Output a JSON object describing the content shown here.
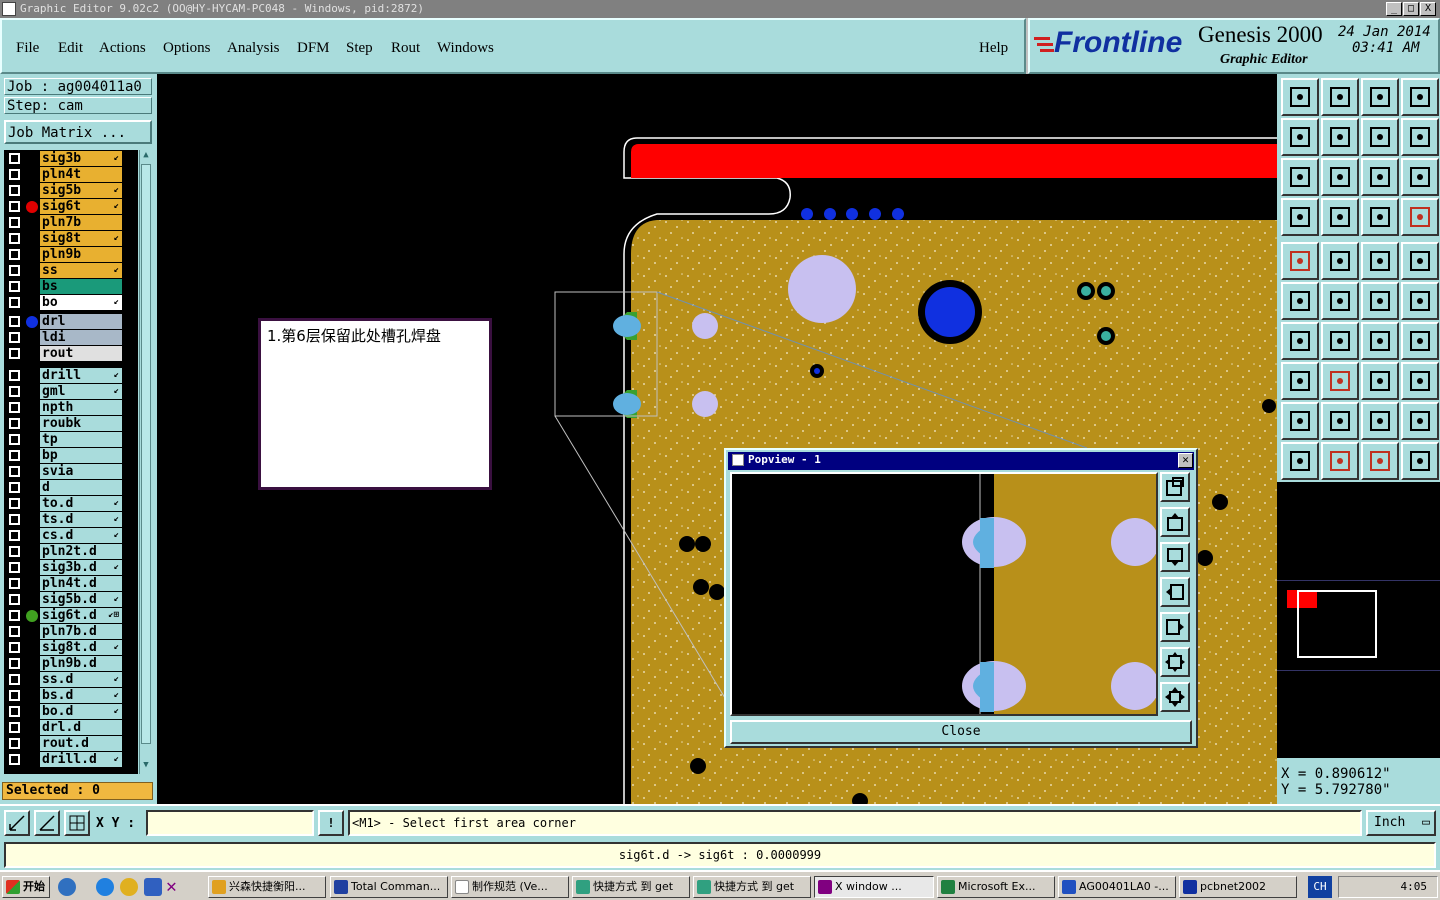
{
  "window": {
    "title": "Graphic Editor 9.02c2 (OO@HY-HYCAM-PC048 - Windows, pid:2872)",
    "controls": [
      "_",
      "□",
      "X"
    ]
  },
  "menubar": {
    "items": [
      "File",
      "Edit",
      "Actions",
      "Options",
      "Analysis",
      "DFM",
      "Step",
      "Rout",
      "Windows"
    ],
    "help": "Help"
  },
  "brand": {
    "logo": "Frontline",
    "product": "Genesis 2000",
    "subtitle": "Graphic Editor",
    "date": "24 Jan 2014",
    "time": "03:41 AM"
  },
  "job": {
    "job_label": "Job : ag004011a0",
    "step_label": "Step: cam",
    "matrix_button": "Job Matrix ..."
  },
  "layers": [
    {
      "name": "sig3b",
      "color": "#e8b030",
      "mark": "↙",
      "dot": ""
    },
    {
      "name": "pln4t",
      "color": "#e8b030",
      "mark": "",
      "dot": ""
    },
    {
      "name": "sig5b",
      "color": "#e8b030",
      "mark": "↙",
      "dot": ""
    },
    {
      "name": "sig6t",
      "color": "#e8b030",
      "mark": "↙",
      "dot": "#e00000"
    },
    {
      "name": "pln7b",
      "color": "#e8b030",
      "mark": "",
      "dot": ""
    },
    {
      "name": "sig8t",
      "color": "#e8b030",
      "mark": "↙",
      "dot": ""
    },
    {
      "name": "pln9b",
      "color": "#e8b030",
      "mark": "",
      "dot": ""
    },
    {
      "name": "ss",
      "color": "#e8b030",
      "mark": "↙",
      "dot": ""
    },
    {
      "name": "bs",
      "color": "#1a9a7a",
      "mark": "",
      "dot": ""
    },
    {
      "name": "bo",
      "color": "#ffffff",
      "mark": "↙",
      "dot": ""
    },
    {
      "name": "drl",
      "color": "#a8b8c8",
      "mark": "",
      "dot": "#1030e0"
    },
    {
      "name": "ldi",
      "color": "#a8b8c8",
      "mark": "",
      "dot": ""
    },
    {
      "name": "rout",
      "color": "#e0e0e0",
      "mark": "",
      "dot": ""
    },
    {
      "name": "drill",
      "color": "#a9dcdc",
      "mark": "↙",
      "dot": ""
    },
    {
      "name": "gml",
      "color": "#a9dcdc",
      "mark": "↙",
      "dot": ""
    },
    {
      "name": "npth",
      "color": "#a9dcdc",
      "mark": "",
      "dot": ""
    },
    {
      "name": "roubk",
      "color": "#a9dcdc",
      "mark": "",
      "dot": ""
    },
    {
      "name": "tp",
      "color": "#a9dcdc",
      "mark": "",
      "dot": ""
    },
    {
      "name": "bp",
      "color": "#a9dcdc",
      "mark": "",
      "dot": ""
    },
    {
      "name": "svia",
      "color": "#a9dcdc",
      "mark": "",
      "dot": ""
    },
    {
      "name": "d",
      "color": "#a9dcdc",
      "mark": "",
      "dot": ""
    },
    {
      "name": "to.d",
      "color": "#a9dcdc",
      "mark": "↙",
      "dot": ""
    },
    {
      "name": "ts.d",
      "color": "#a9dcdc",
      "mark": "↙",
      "dot": ""
    },
    {
      "name": "cs.d",
      "color": "#a9dcdc",
      "mark": "↙",
      "dot": ""
    },
    {
      "name": "pln2t.d",
      "color": "#a9dcdc",
      "mark": "",
      "dot": ""
    },
    {
      "name": "sig3b.d",
      "color": "#a9dcdc",
      "mark": "↙",
      "dot": ""
    },
    {
      "name": "pln4t.d",
      "color": "#a9dcdc",
      "mark": "",
      "dot": ""
    },
    {
      "name": "sig5b.d",
      "color": "#a9dcdc",
      "mark": "↙",
      "dot": ""
    },
    {
      "name": "sig6t.d",
      "color": "#a9dcdc",
      "mark": "↙⊞",
      "dot": "#40a020"
    },
    {
      "name": "pln7b.d",
      "color": "#a9dcdc",
      "mark": "",
      "dot": ""
    },
    {
      "name": "sig8t.d",
      "color": "#a9dcdc",
      "mark": "↙",
      "dot": ""
    },
    {
      "name": "pln9b.d",
      "color": "#a9dcdc",
      "mark": "",
      "dot": ""
    },
    {
      "name": "ss.d",
      "color": "#a9dcdc",
      "mark": "↙",
      "dot": ""
    },
    {
      "name": "bs.d",
      "color": "#a9dcdc",
      "mark": "↙",
      "dot": ""
    },
    {
      "name": "bo.d",
      "color": "#a9dcdc",
      "mark": "↙",
      "dot": ""
    },
    {
      "name": "drl.d",
      "color": "#a9dcdc",
      "mark": "",
      "dot": ""
    },
    {
      "name": "rout.d",
      "color": "#a9dcdc",
      "mark": "",
      "dot": ""
    },
    {
      "name": "drill.d",
      "color": "#a9dcdc",
      "mark": "↙",
      "dot": ""
    }
  ],
  "selected": "Selected : 0",
  "note": {
    "text": "1.第6层保留此处槽孔焊盘"
  },
  "popview": {
    "title": "Popview - 1",
    "close_label": "Close"
  },
  "coords": {
    "x": "X = 0.890612\"",
    "y": "Y = 5.792780\""
  },
  "statusbar": {
    "xy_label": "X Y :",
    "xy_value": "",
    "prompt": "<M1> - Select first area corner",
    "units": "Inch",
    "compare": "sig6t.d -> sig6t : 0.0000999"
  },
  "taskbar": {
    "start": "开始",
    "tasks": [
      "兴森快捷衡阳...",
      "Total Comman...",
      "制作规范 (Ve...",
      "快捷方式 到 get",
      "快捷方式 到 get",
      "X window ...",
      "Microsoft Ex...",
      "AG00401LA0 -...",
      "pcbnet2002"
    ],
    "lang": "CH",
    "clock": "4:05"
  }
}
